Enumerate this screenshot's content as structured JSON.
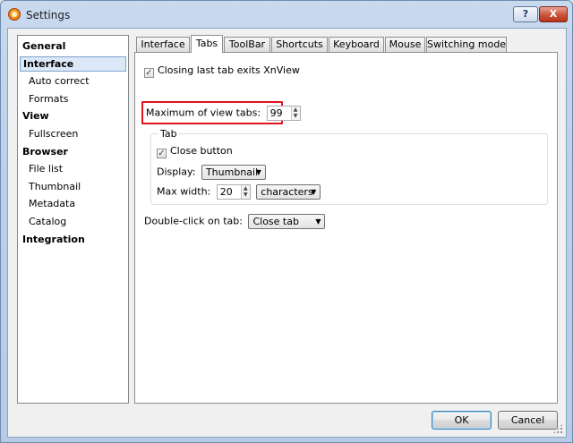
{
  "window": {
    "title": "Settings",
    "help_label": "?",
    "close_label": "X"
  },
  "sidebar": {
    "items": [
      {
        "label": "General",
        "kind": "group"
      },
      {
        "label": "Interface",
        "kind": "group",
        "selected": true
      },
      {
        "label": "Auto correct",
        "kind": "sub"
      },
      {
        "label": "Formats",
        "kind": "sub"
      },
      {
        "label": "View",
        "kind": "group"
      },
      {
        "label": "Fullscreen",
        "kind": "sub"
      },
      {
        "label": "Browser",
        "kind": "group"
      },
      {
        "label": "File list",
        "kind": "sub"
      },
      {
        "label": "Thumbnail",
        "kind": "sub"
      },
      {
        "label": "Metadata",
        "kind": "sub"
      },
      {
        "label": "Catalog",
        "kind": "sub"
      },
      {
        "label": "Integration",
        "kind": "group"
      }
    ]
  },
  "tabs": [
    {
      "label": "Interface"
    },
    {
      "label": "Tabs",
      "active": true
    },
    {
      "label": "ToolBar"
    },
    {
      "label": "Shortcuts"
    },
    {
      "label": "Keyboard"
    },
    {
      "label": "Mouse"
    },
    {
      "label": "Switching mode"
    }
  ],
  "panel": {
    "closing_last_tab": {
      "label": "Closing last tab exits XnView",
      "checked": true
    },
    "max_view_tabs": {
      "label": "Maximum of view tabs:",
      "value": "99"
    },
    "tab_group": {
      "title": "Tab",
      "close_button": {
        "label": "Close button",
        "checked": true
      },
      "display": {
        "label": "Display:",
        "value": "Thumbnail"
      },
      "max_width": {
        "label": "Max width:",
        "value": "20",
        "unit": "characters"
      }
    },
    "double_click": {
      "label": "Double-click on tab:",
      "value": "Close tab"
    }
  },
  "footer": {
    "ok_label": "OK",
    "cancel_label": "Cancel"
  },
  "colors": {
    "highlight": "#e0141a",
    "selection": "#dce8f7"
  },
  "icons": {
    "checkmark": "✓",
    "dropdown": "▼",
    "spin_up": "▲",
    "spin_down": "▼"
  }
}
